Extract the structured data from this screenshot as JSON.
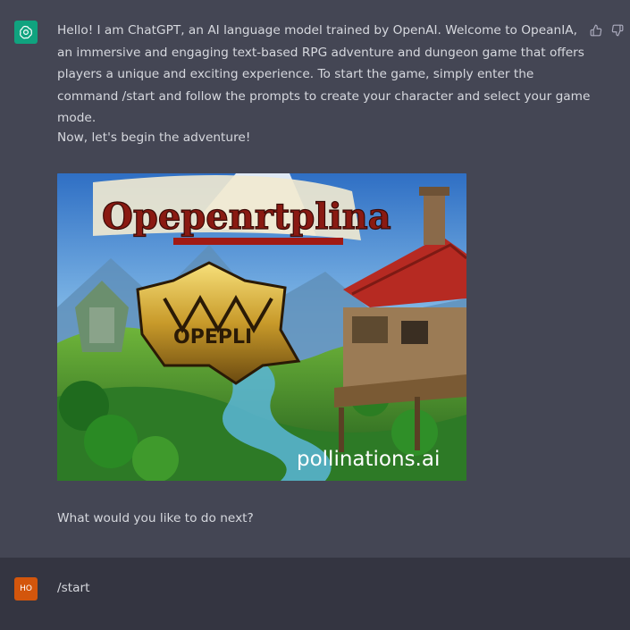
{
  "assistant": {
    "intro": "Hello! I am ChatGPT, an AI language model trained by OpenAI. Welcome to OpeanIA, an immersive and engaging text-based RPG adventure and dungeon game that offers players a unique and exciting experience. To start the game, simply enter the command /start and follow the prompts to create your character and select your game mode.",
    "begin": "Now, let's begin the adventure!",
    "image": {
      "title_art": "Opepenrtplina",
      "emblem_text": "OPEPLI",
      "watermark": "pollinations.ai"
    },
    "next_prompt": "What would you like to do next?",
    "avatar_icon": "openai-logo-icon",
    "feedback_icons": [
      "thumbs-up-icon",
      "thumbs-down-icon"
    ]
  },
  "user": {
    "avatar_initials": "HO",
    "message": "/start"
  },
  "colors": {
    "assistant_bg": "#444654",
    "user_bg": "#343541",
    "gpt_avatar": "#10a37f",
    "user_avatar": "#d3560c"
  }
}
